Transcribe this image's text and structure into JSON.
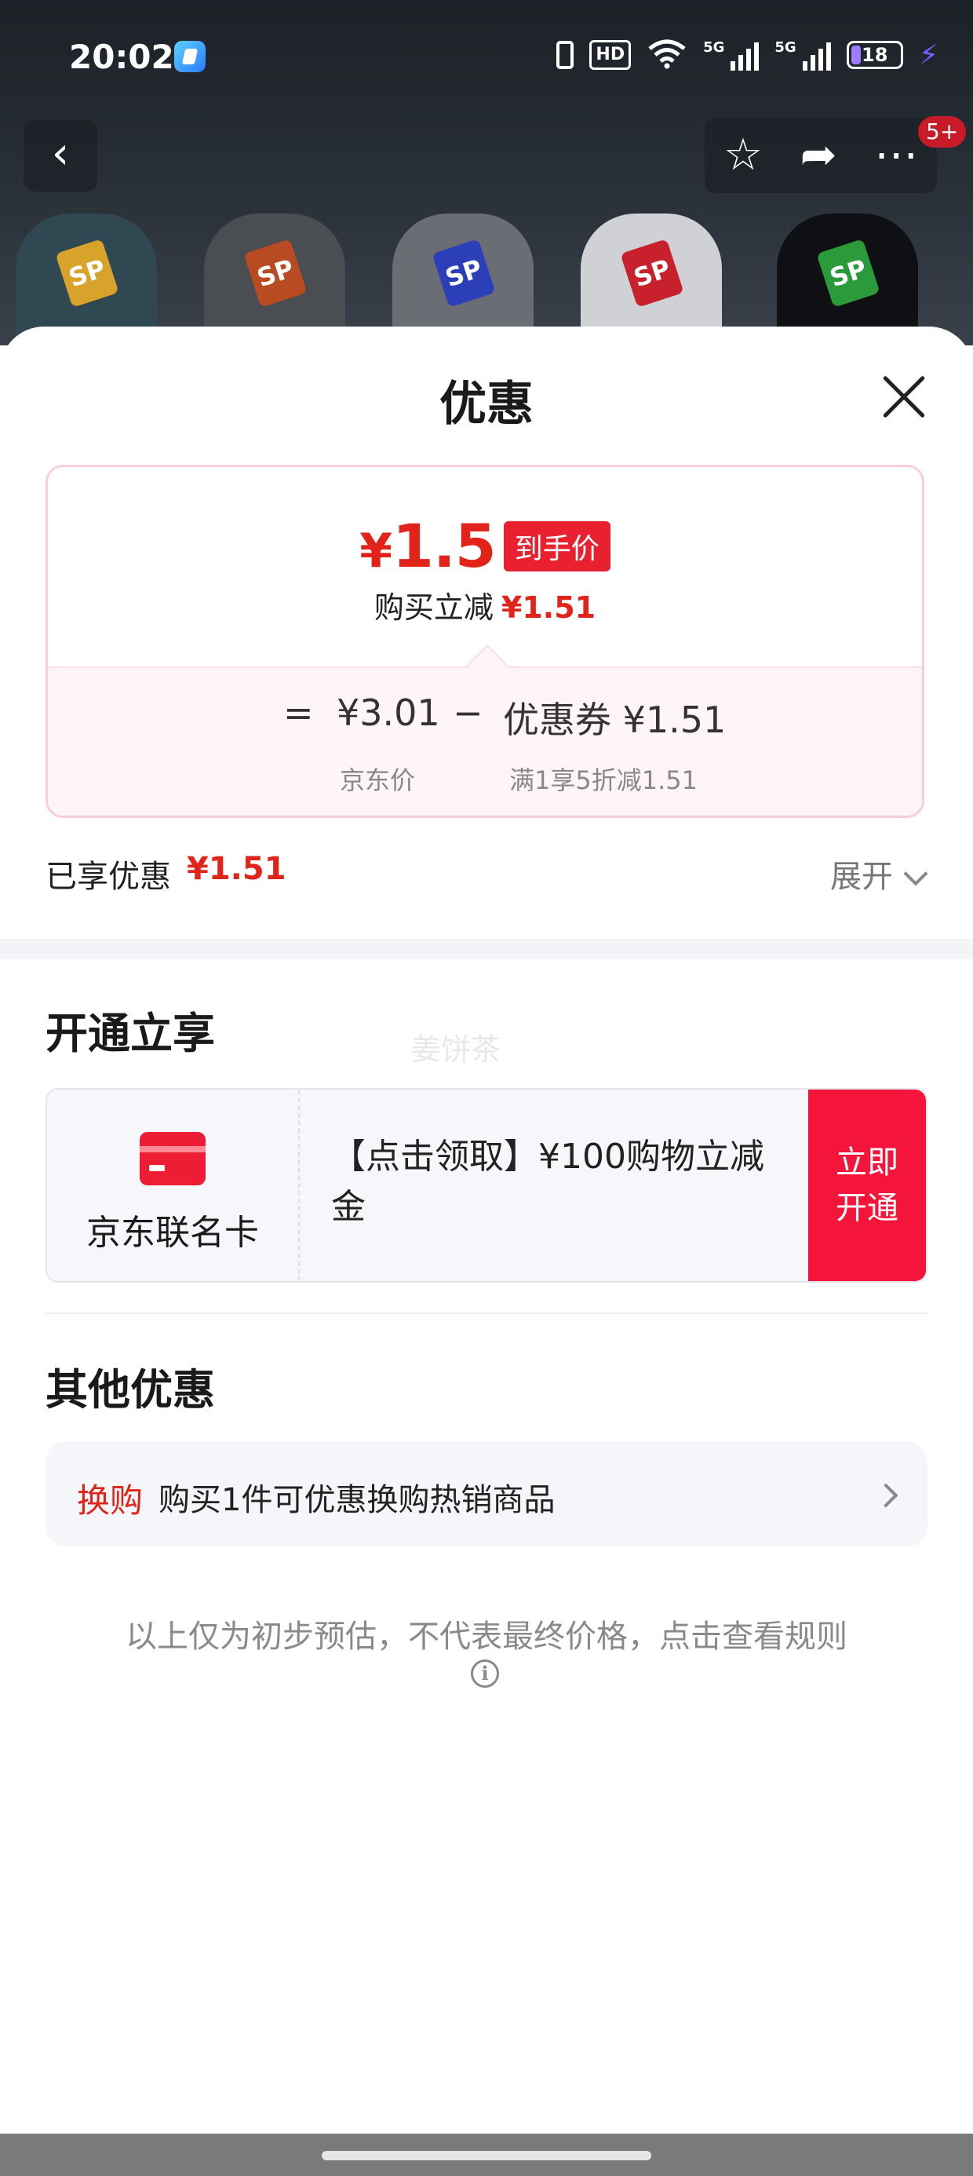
{
  "status_bar": {
    "time": "20:02",
    "hd": "HD",
    "signal_1": "5G",
    "signal_2": "5G",
    "battery": "18",
    "battery_fraction": 0.18
  },
  "background_page": {
    "badge_count": "5+",
    "sock_tags": [
      "SP",
      "SP",
      "SP",
      "SP",
      "SP"
    ]
  },
  "sheet": {
    "title": "优惠"
  },
  "price": {
    "currency": "¥",
    "final_value": "1.5",
    "final_tag": "到手价",
    "save_label": "购买立减",
    "save_value": "¥1.51",
    "equals": "=",
    "jd_price": "¥3.01",
    "jd_price_caption": "京东价",
    "minus": "−",
    "coupon_label": "优惠券 ¥1.51",
    "coupon_caption": "满1享5折减1.51"
  },
  "enjoyed": {
    "label": "已享优惠",
    "value": "¥1.51",
    "expand_label": "展开"
  },
  "activate": {
    "title": "开通立享",
    "watermark": "姜饼茶",
    "card_name": "京东联名卡",
    "offer_text": "【点击领取】¥100购物立减金",
    "button_label": "立即开通"
  },
  "other": {
    "title": "其他优惠",
    "swap_tag": "换购",
    "swap_text": "购买1件可优惠换购热销商品"
  },
  "footer": {
    "disclaimer": "以上仅为初步预估，不代表最终价格，点击查看规则"
  },
  "colors": {
    "accent_red": "#e2231a",
    "button_red": "#f5143a",
    "card_border_pink": "#f7cfd5"
  }
}
